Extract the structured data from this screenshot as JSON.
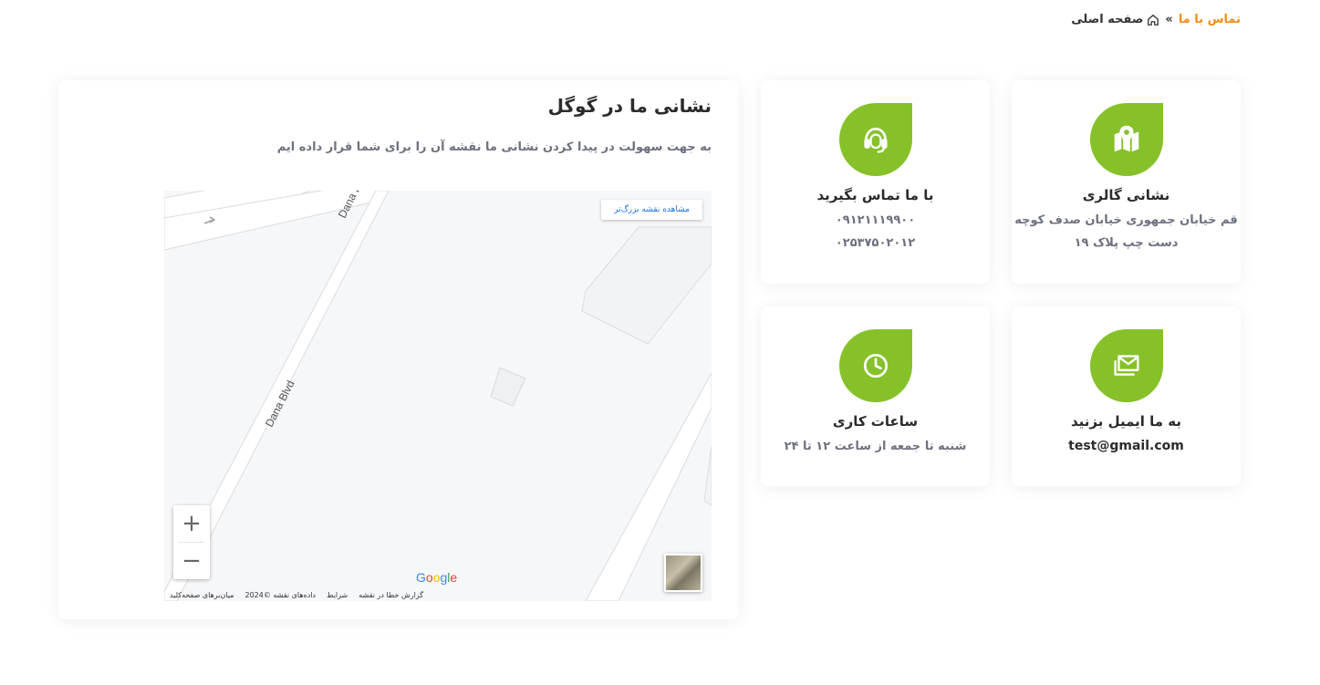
{
  "breadcrumb": {
    "home": "صفحه اصلی",
    "separator": "»",
    "current": "تماس با ما"
  },
  "cards": {
    "address": {
      "icon": "map-pin-icon",
      "title": "نشانی گالری",
      "line1": "قم خیابان جمهوری خیابان صدف کوچه",
      "line2": "دست چپ پلاک ۱۹"
    },
    "phone": {
      "icon": "headset-icon",
      "title": "با ما تماس بگیرید",
      "line1": "۰۹۱۲۱۱۱۹۹۰۰",
      "line2": "۰۲۵۳۷۵۰۲۰۱۲"
    },
    "email": {
      "icon": "mail-icon",
      "title": "به ما ایمیل بزنید",
      "line1": "test@gmail.com"
    },
    "hours": {
      "icon": "clock-icon",
      "title": "ساعات کاری",
      "line1": "شنبه تا جمعه از ساعت ۱۲ تا ۲۴"
    }
  },
  "map_section": {
    "title": "نشانی ما در گوگل",
    "subtitle": "به جهت سهولت در پیدا کردن نشانی ما نقشه آن را برای شما قرار داده ایم",
    "larger_map": "مشاهده نقشه بزرگ‌تر",
    "zoom_in": "+",
    "zoom_out": "−",
    "street_label": "Dana Blvd",
    "google_logo": "Google",
    "attribution": {
      "shortcuts": "میان‌برهای صفحه‌کلید",
      "map_data": "داده‌های نقشه ©2024",
      "terms": "شرایط",
      "report": "گزارش خطا در نقشه"
    }
  },
  "colors": {
    "accent": "#86c12a",
    "breadcrumb_active": "#f28c16",
    "muted_text": "#6e7180"
  }
}
